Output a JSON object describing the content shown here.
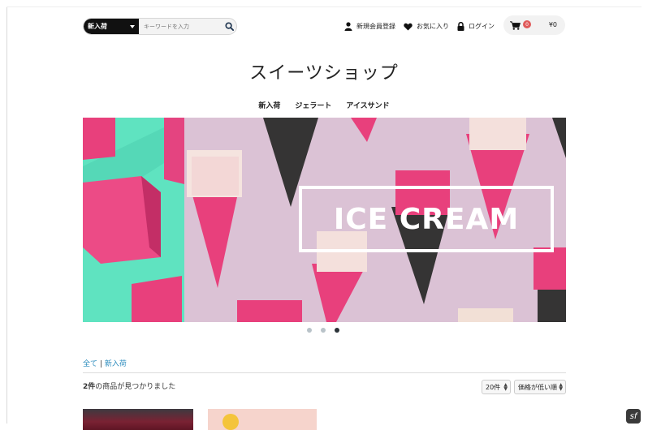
{
  "header": {
    "category_select": "新入荷",
    "search_placeholder": "キーワードを入力",
    "signup": "新規会員登録",
    "favorites": "お気に入り",
    "login": "ログイン",
    "cart_count": "0",
    "cart_total": "¥0"
  },
  "shop_title": "スイーツショップ",
  "categories": [
    "新入荷",
    "ジェラート",
    "アイスサンド"
  ],
  "banner": {
    "text": "ICE CREAM",
    "slide_count": 3,
    "active_slide": 3
  },
  "breadcrumb": {
    "all": "全て",
    "sep": "|",
    "current": "新入荷"
  },
  "results": {
    "count": "2件",
    "text": "の商品が見つかりました"
  },
  "controls": {
    "per_page": "20件",
    "sort": "価格が低い順"
  },
  "colors": {
    "accent_link": "#2a8bbd",
    "cart_badge": "#e05a5a",
    "banner_bg": "#dcc3d6",
    "mint": "#5fe3c0",
    "pink": "#e8407c"
  },
  "icons": {
    "search": "search-icon",
    "user": "user-icon",
    "heart": "heart-icon",
    "lock": "lock-icon",
    "cart": "cart-icon"
  }
}
